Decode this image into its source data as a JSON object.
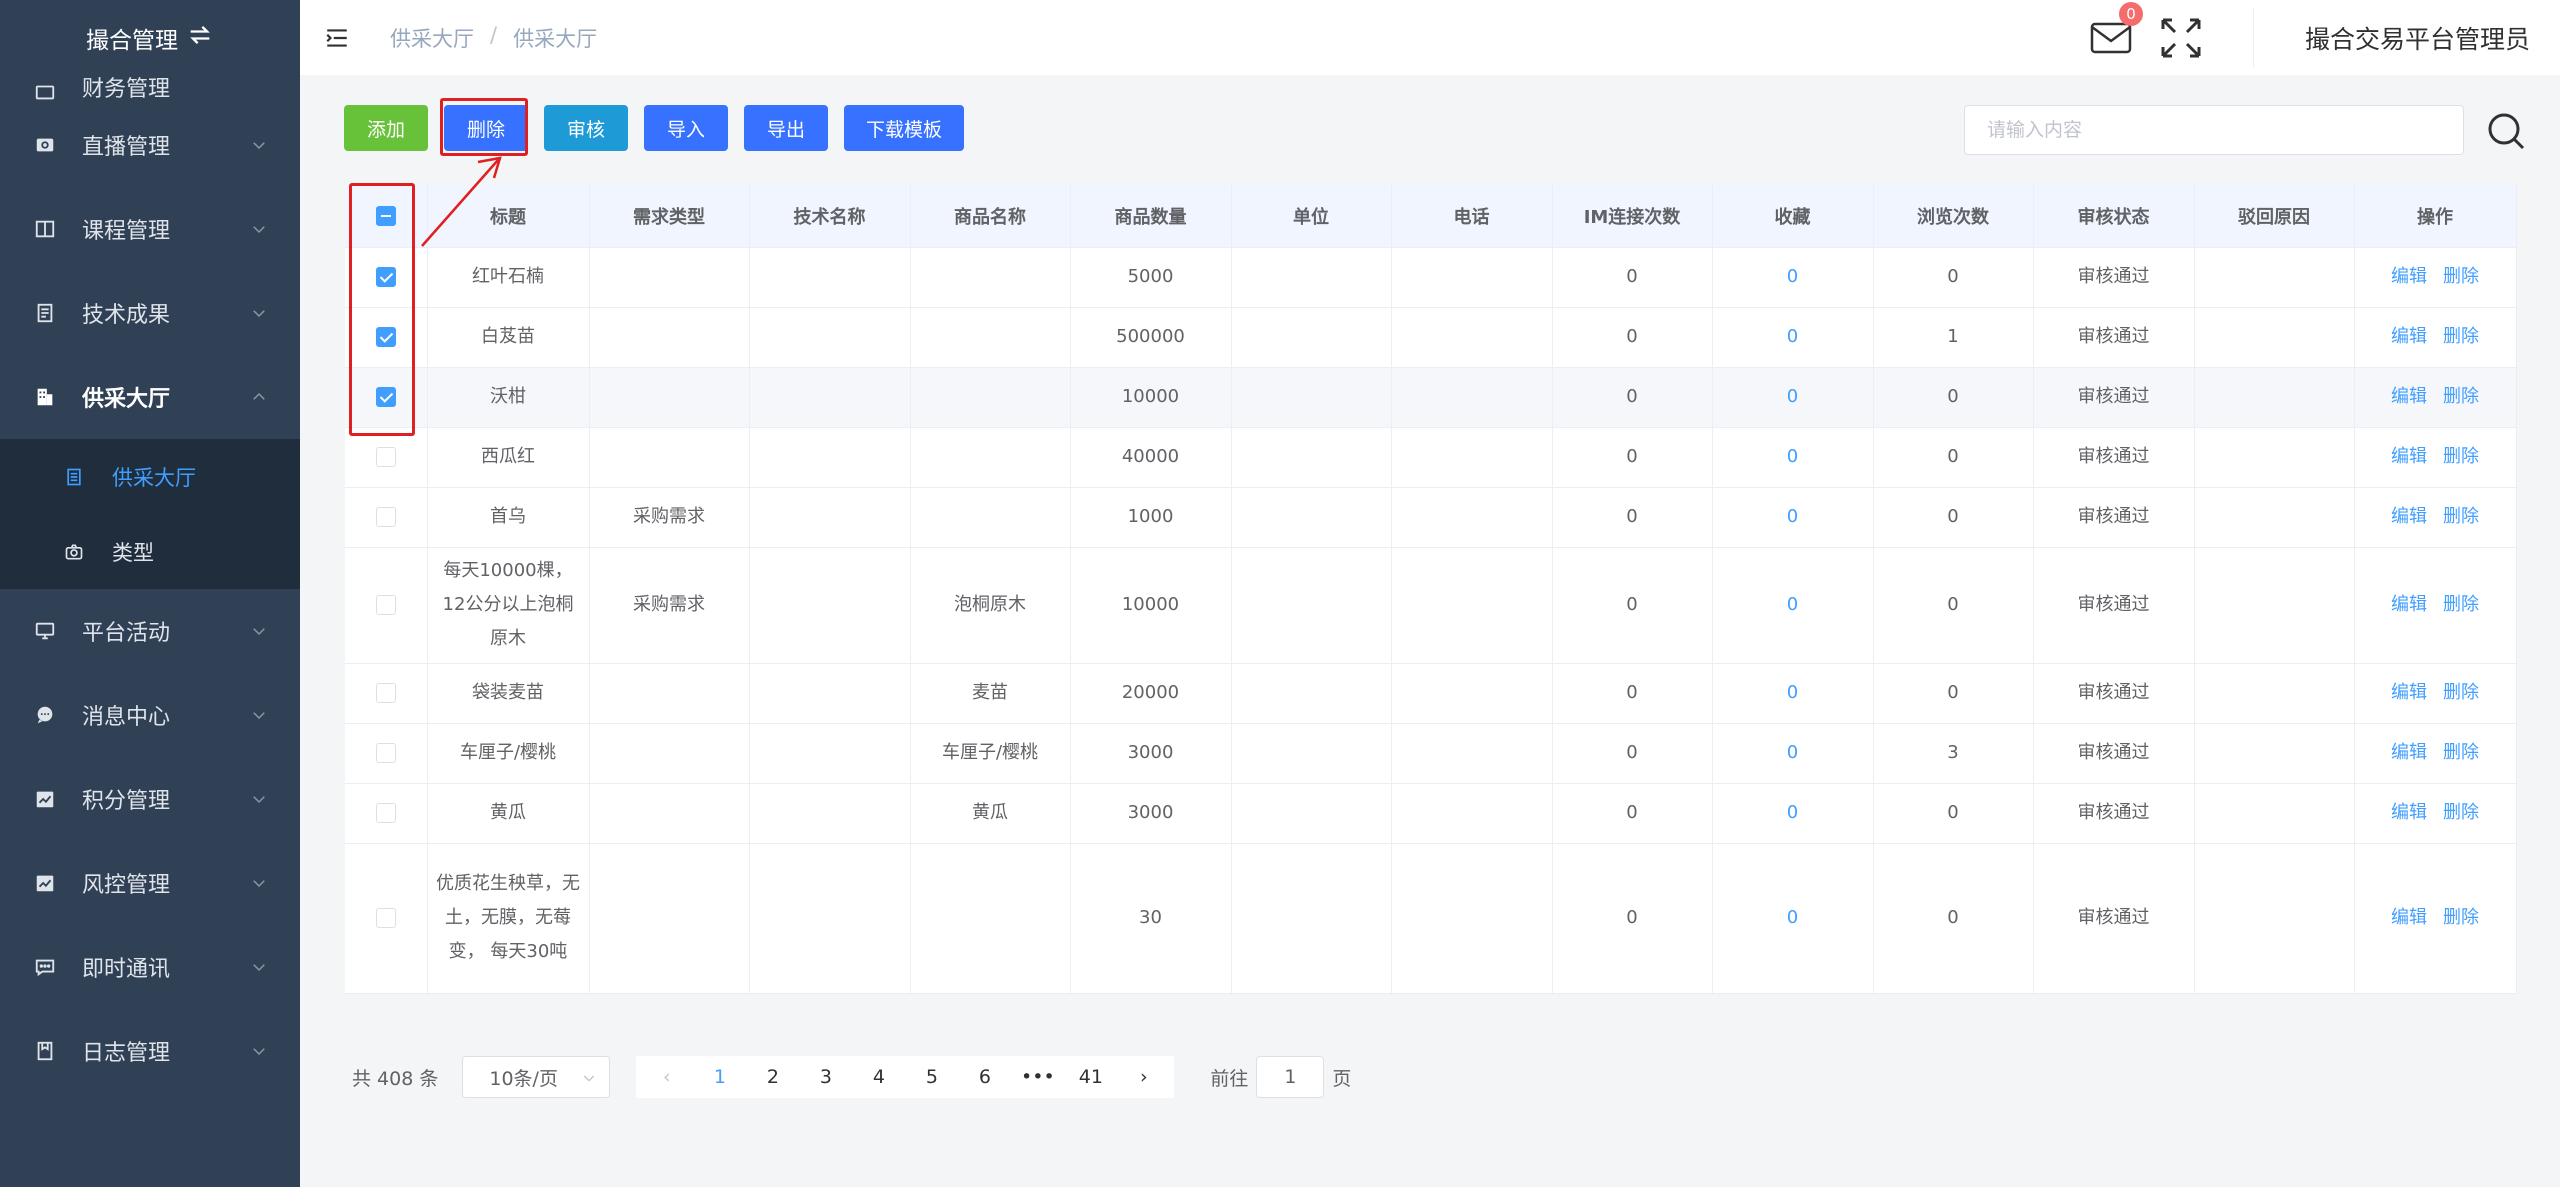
{
  "sidebar": {
    "title": "撮合管理",
    "partial_item": "财务管理",
    "items": [
      {
        "label": "直播管理",
        "icon": "camera-icon"
      },
      {
        "label": "课程管理",
        "icon": "book-icon"
      },
      {
        "label": "技术成果",
        "icon": "document-icon"
      },
      {
        "label": "供采大厅",
        "icon": "building-icon"
      }
    ],
    "submenu": [
      {
        "label": "供采大厅",
        "icon": "list-icon"
      },
      {
        "label": "类型",
        "icon": "camera-icon"
      }
    ],
    "items_after": [
      {
        "label": "平台活动",
        "icon": "monitor-icon"
      },
      {
        "label": "消息中心",
        "icon": "chat-icon"
      },
      {
        "label": "积分管理",
        "icon": "chart-icon"
      },
      {
        "label": "风控管理",
        "icon": "chart-icon"
      },
      {
        "label": "即时通讯",
        "icon": "message-icon"
      },
      {
        "label": "日志管理",
        "icon": "log-icon"
      }
    ]
  },
  "header": {
    "breadcrumb": [
      "供采大厅",
      "供采大厅"
    ],
    "mail_count": "0",
    "admin_name": "撮合交易平台管理员"
  },
  "toolbar": {
    "add": "添加",
    "delete": "删除",
    "audit": "审核",
    "import": "导入",
    "export": "导出",
    "template": "下载模板"
  },
  "search": {
    "placeholder": "请输入内容"
  },
  "table": {
    "columns": [
      "标题",
      "需求类型",
      "技术名称",
      "商品名称",
      "商品数量",
      "单位",
      "电话",
      "IM连接次数",
      "收藏",
      "浏览次数",
      "审核状态",
      "驳回原因",
      "操作"
    ],
    "edit_label": "编辑",
    "delete_label": "删除",
    "rows": [
      {
        "checked": true,
        "title": "红叶石楠",
        "demand": "",
        "tech": "",
        "product": "",
        "qty": "5000",
        "unit": "",
        "phone": "",
        "im": "0",
        "fav": "0",
        "views": "0",
        "status": "审核通过",
        "reason": ""
      },
      {
        "checked": true,
        "title": "白芨苗",
        "demand": "",
        "tech": "",
        "product": "",
        "qty": "500000",
        "unit": "",
        "phone": "",
        "im": "0",
        "fav": "0",
        "views": "1",
        "status": "审核通过",
        "reason": ""
      },
      {
        "checked": true,
        "title": "沃柑",
        "demand": "",
        "tech": "",
        "product": "",
        "qty": "10000",
        "unit": "",
        "phone": "",
        "im": "0",
        "fav": "0",
        "views": "0",
        "status": "审核通过",
        "reason": ""
      },
      {
        "checked": false,
        "title": "西瓜红",
        "demand": "",
        "tech": "",
        "product": "",
        "qty": "40000",
        "unit": "",
        "phone": "",
        "im": "0",
        "fav": "0",
        "views": "0",
        "status": "审核通过",
        "reason": ""
      },
      {
        "checked": false,
        "title": "首乌",
        "demand": "采购需求",
        "tech": "",
        "product": "",
        "qty": "1000",
        "unit": "",
        "phone": "",
        "im": "0",
        "fav": "0",
        "views": "0",
        "status": "审核通过",
        "reason": ""
      },
      {
        "checked": false,
        "title": "每天10000棵，12公分以上泡桐原木",
        "demand": "采购需求",
        "tech": "",
        "product": "泡桐原木",
        "qty": "10000",
        "unit": "",
        "phone": "",
        "im": "0",
        "fav": "0",
        "views": "0",
        "status": "审核通过",
        "reason": ""
      },
      {
        "checked": false,
        "title": "袋装麦苗",
        "demand": "",
        "tech": "",
        "product": "麦苗",
        "qty": "20000",
        "unit": "",
        "phone": "",
        "im": "0",
        "fav": "0",
        "views": "0",
        "status": "审核通过",
        "reason": ""
      },
      {
        "checked": false,
        "title": "车厘子/樱桃",
        "demand": "",
        "tech": "",
        "product": "车厘子/樱桃",
        "qty": "3000",
        "unit": "",
        "phone": "",
        "im": "0",
        "fav": "0",
        "views": "3",
        "status": "审核通过",
        "reason": ""
      },
      {
        "checked": false,
        "title": "黄瓜",
        "demand": "",
        "tech": "",
        "product": "黄瓜",
        "qty": "3000",
        "unit": "",
        "phone": "",
        "im": "0",
        "fav": "0",
        "views": "0",
        "status": "审核通过",
        "reason": ""
      },
      {
        "checked": false,
        "title": "优质花生秧草，无土，无膜，无莓变， 每天30吨",
        "demand": "",
        "tech": "",
        "product": "",
        "qty": "30",
        "unit": "",
        "phone": "",
        "im": "0",
        "fav": "0",
        "views": "0",
        "status": "审核通过",
        "reason": ""
      }
    ]
  },
  "pagination": {
    "total": "共 408 条",
    "page_size": "10条/页",
    "pages": [
      "1",
      "2",
      "3",
      "4",
      "5",
      "6",
      "•••",
      "41"
    ],
    "current": "1",
    "goto_prefix": "前往",
    "goto_value": "1",
    "goto_suffix": "页"
  },
  "colors": {
    "sidebar_bg": "#304156",
    "submenu_bg": "#1f2d3d",
    "primary": "#409eff",
    "button_blue": "#3671ff",
    "button_green": "#67c23a",
    "annotation_red": "#e02020"
  }
}
